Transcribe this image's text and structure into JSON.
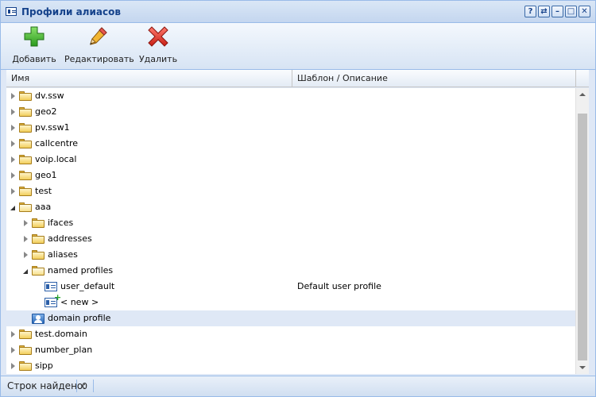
{
  "window": {
    "title": "Профили алиасов"
  },
  "title_tools": [
    "?",
    "⇄",
    "–",
    "□",
    "✕"
  ],
  "toolbar": {
    "add_label": "Добавить",
    "edit_label": "Редактировать",
    "delete_label": "Удалить"
  },
  "grid": {
    "columns": [
      "Имя",
      "Шаблон / Описание"
    ],
    "rows": [
      {
        "label": "dv.ssw",
        "level": 0,
        "type": "folder",
        "expander": "collapsed",
        "description": ""
      },
      {
        "label": "geo2",
        "level": 0,
        "type": "folder",
        "expander": "collapsed",
        "description": ""
      },
      {
        "label": "pv.ssw1",
        "level": 0,
        "type": "folder",
        "expander": "collapsed",
        "description": ""
      },
      {
        "label": "callcentre",
        "level": 0,
        "type": "folder",
        "expander": "collapsed",
        "description": ""
      },
      {
        "label": "voip.local",
        "level": 0,
        "type": "folder",
        "expander": "collapsed",
        "description": ""
      },
      {
        "label": "geo1",
        "level": 0,
        "type": "folder",
        "expander": "collapsed",
        "description": ""
      },
      {
        "label": "test",
        "level": 0,
        "type": "folder",
        "expander": "collapsed",
        "description": ""
      },
      {
        "label": "aaa",
        "level": 0,
        "type": "folder-open",
        "expander": "expanded",
        "description": ""
      },
      {
        "label": "ifaces",
        "level": 1,
        "type": "folder",
        "expander": "collapsed",
        "description": ""
      },
      {
        "label": "addresses",
        "level": 1,
        "type": "folder",
        "expander": "collapsed",
        "description": ""
      },
      {
        "label": "aliases",
        "level": 1,
        "type": "folder",
        "expander": "collapsed",
        "description": ""
      },
      {
        "label": "named profiles",
        "level": 1,
        "type": "folder-open",
        "expander": "expanded",
        "description": ""
      },
      {
        "label": "user_default",
        "level": 2,
        "type": "card",
        "expander": "none",
        "description": "Default user profile"
      },
      {
        "label": "< new >",
        "level": 2,
        "type": "card-new",
        "expander": "none",
        "description": ""
      },
      {
        "label": "domain profile",
        "level": 1,
        "type": "profile",
        "expander": "none",
        "description": "",
        "selected": true
      },
      {
        "label": "test.domain",
        "level": 0,
        "type": "folder",
        "expander": "collapsed",
        "description": ""
      },
      {
        "label": "number_plan",
        "level": 0,
        "type": "folder",
        "expander": "collapsed",
        "description": ""
      },
      {
        "label": "sipp",
        "level": 0,
        "type": "folder",
        "expander": "collapsed",
        "description": ""
      }
    ]
  },
  "status": {
    "label": "Строк найдено:",
    "value": "0"
  },
  "icons": {
    "add": "green-plus-icon",
    "edit": "pencil-icon",
    "delete": "red-x-icon"
  }
}
